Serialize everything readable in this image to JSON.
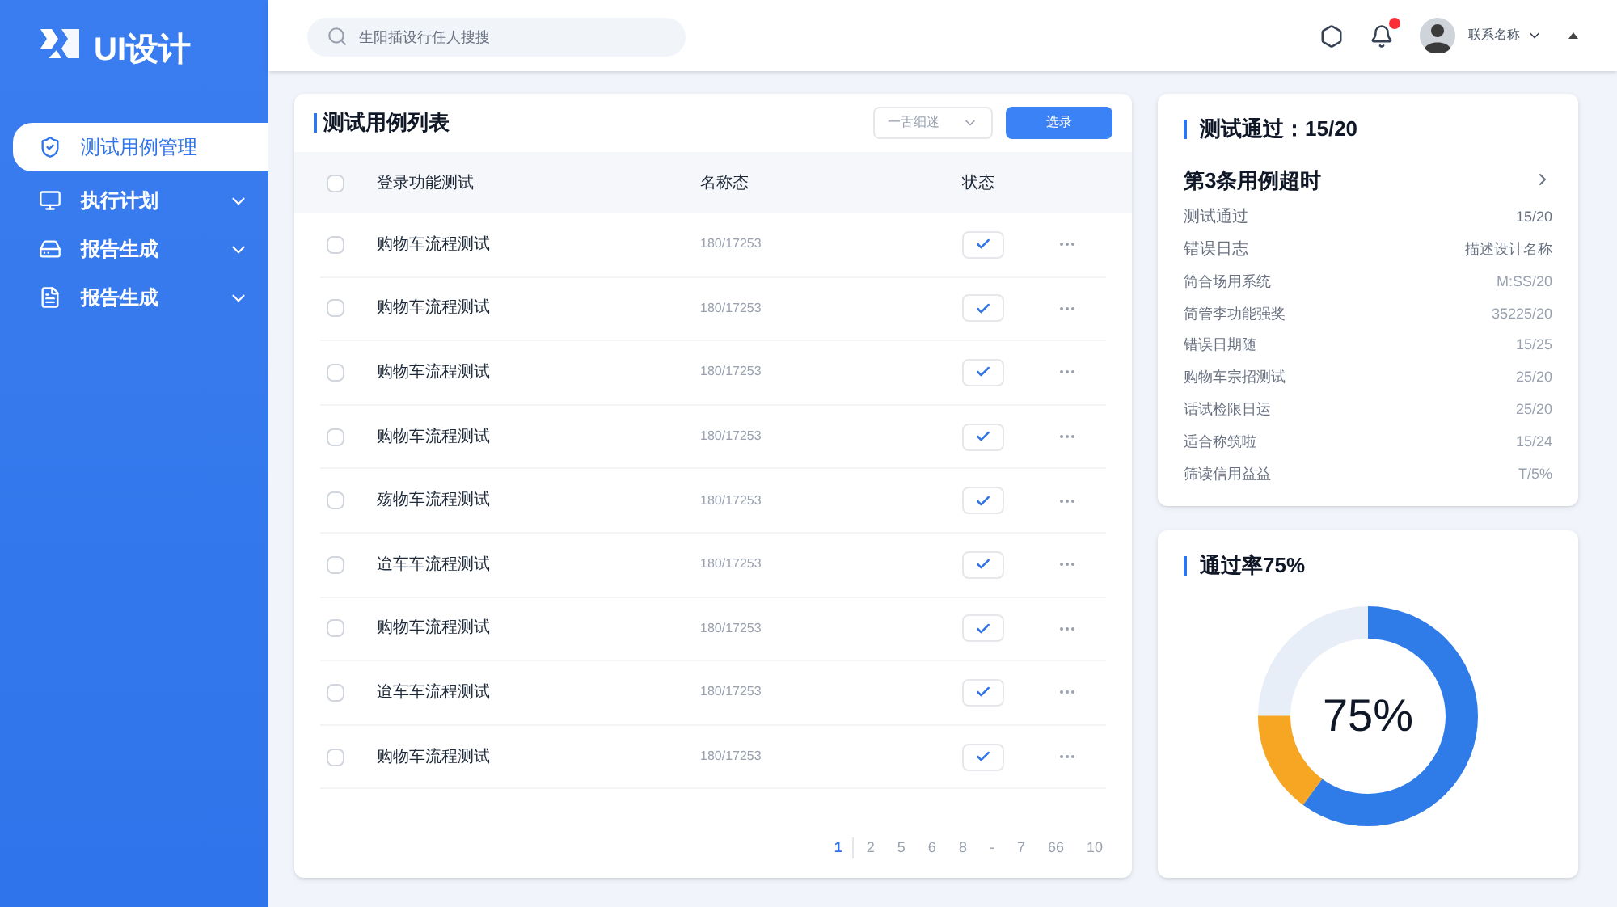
{
  "logo": {
    "text": "UI设计"
  },
  "sidebar": {
    "items": [
      {
        "label": "测试用例管理",
        "selected": true,
        "has_caret": false
      },
      {
        "label": "执行计划",
        "selected": false,
        "has_caret": true
      },
      {
        "label": "报告生成",
        "selected": false,
        "has_caret": true
      },
      {
        "label": "报告生成",
        "selected": false,
        "has_caret": true
      }
    ]
  },
  "header": {
    "search": {
      "placeholder": "生阳插设行任人搜搜"
    },
    "notification_badge": true,
    "user_name": "联系名称"
  },
  "test_table": {
    "title": "测试用例列表",
    "filter": {
      "value": "一舌细迷"
    },
    "button": "选录",
    "header_checked": false,
    "columns": [
      "登录功能测试",
      "名称态",
      "状态"
    ],
    "rows": [
      {
        "name": "购物车流程测试",
        "code": "180/17253",
        "checked": false,
        "status": true
      },
      {
        "name": "购物车流程测试",
        "code": "180/17253",
        "checked": false,
        "status": true
      },
      {
        "name": "购物车流程测试",
        "code": "180/17253",
        "checked": false,
        "status": true
      },
      {
        "name": "购物车流程测试",
        "code": "180/17253",
        "checked": false,
        "status": true
      },
      {
        "name": "殇物车流程测试",
        "code": "180/17253",
        "checked": false,
        "status": true
      },
      {
        "name": "迨车车流程测试",
        "code": "180/17253",
        "checked": false,
        "status": true
      },
      {
        "name": "购物车流程测试",
        "code": "180/17253",
        "checked": false,
        "status": true
      },
      {
        "name": "迨车车流程测试",
        "code": "180/17253",
        "checked": false,
        "status": true
      },
      {
        "name": "购物车流程测试",
        "code": "180/17253",
        "checked": false,
        "status": true
      }
    ],
    "pagination": [
      {
        "label": "1",
        "selected": true
      },
      {
        "label": "2",
        "selected": false
      },
      {
        "label": "5",
        "selected": false
      },
      {
        "label": "6",
        "selected": false
      },
      {
        "label": "8",
        "selected": false
      },
      {
        "label": "-",
        "selected": false
      },
      {
        "label": "7",
        "selected": false
      },
      {
        "label": "66",
        "selected": false
      },
      {
        "label": "10",
        "selected": false
      }
    ]
  },
  "summary": {
    "title": "测试通过：15/20",
    "subtitle": "第3条用例超时",
    "items": [
      {
        "label": "测试通过",
        "value": "15/20",
        "kind": "primary"
      },
      {
        "label": "错误日志",
        "value": "描述设计名称",
        "kind": "primary"
      },
      {
        "label": "简合场用系统",
        "value": "M:SS/20",
        "kind": "muted"
      },
      {
        "label": "简管李功能强奖",
        "value": "35225/20",
        "kind": "muted"
      },
      {
        "label": "错误日期随",
        "value": "15/25",
        "kind": "muted"
      },
      {
        "label": "购物车宗招测试",
        "value": "25/20",
        "kind": "muted"
      },
      {
        "label": "话试检限日运",
        "value": "25/20",
        "kind": "muted"
      },
      {
        "label": "适合称筑啦",
        "value": "15/24",
        "kind": "muted"
      },
      {
        "label": "筛读信用益益",
        "value": "T/5%",
        "kind": "muted"
      }
    ]
  },
  "pass_rate": {
    "title": "通过率75%",
    "center_label": "75%"
  }
}
